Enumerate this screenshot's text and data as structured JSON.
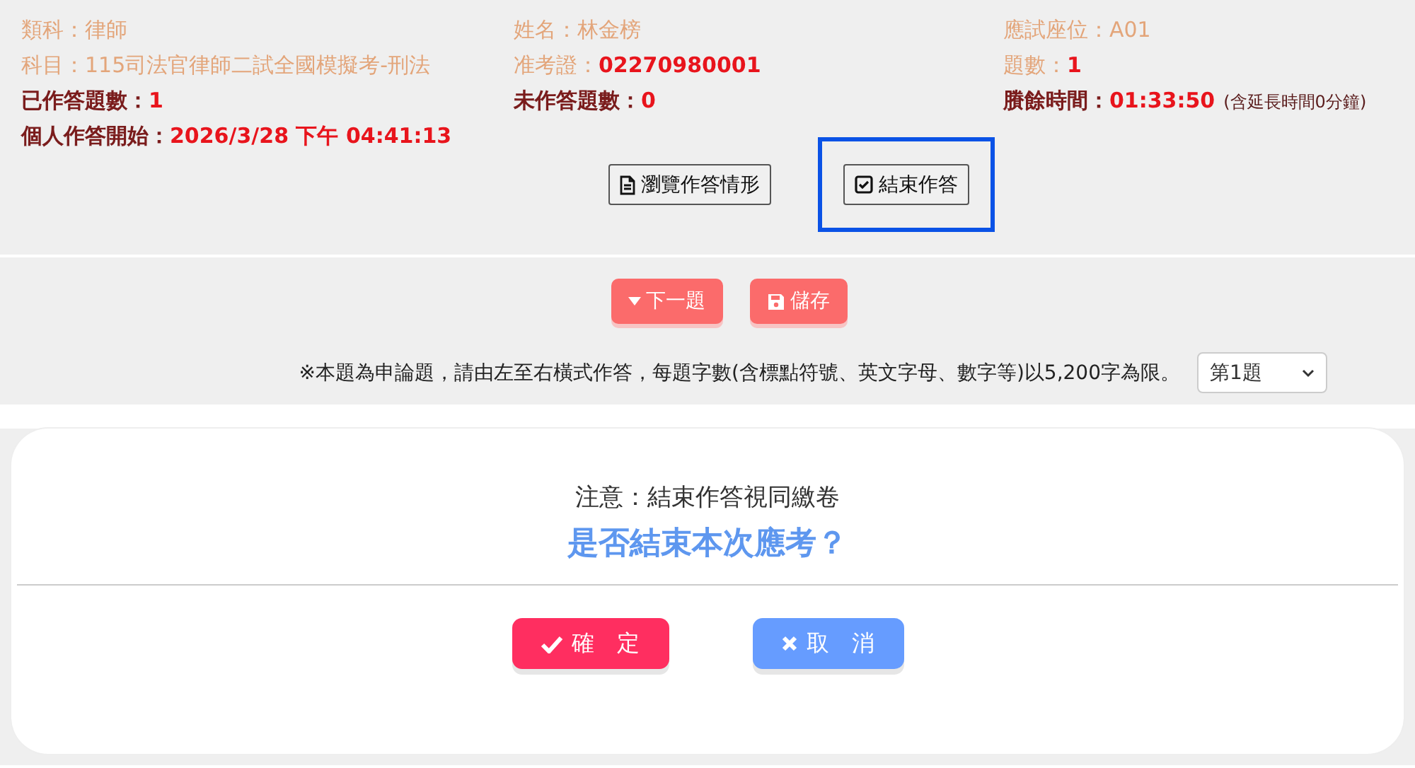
{
  "info": [
    {
      "label": "類科：",
      "value": "律師",
      "dark": false,
      "emphasis": false
    },
    {
      "label": "姓名：",
      "value": "林金榜",
      "dark": false,
      "emphasis": false
    },
    {
      "label": "應試座位：",
      "value": "A01",
      "dark": false,
      "emphasis": false
    },
    {
      "label": "科目：",
      "value": "115司法官律師二試全國模擬考-刑法",
      "dark": false,
      "emphasis": false
    },
    {
      "label": "准考證：",
      "value": "02270980001",
      "dark": false,
      "emphasis": true
    },
    {
      "label": "題數：",
      "value": "1",
      "dark": false,
      "emphasis": true
    },
    {
      "label": "已作答題數：",
      "value": "1",
      "dark": true,
      "emphasis": true
    },
    {
      "label": "未作答題數：",
      "value": "0",
      "dark": true,
      "emphasis": true
    },
    {
      "label": "賸餘時間：",
      "value": "01:33:50",
      "dark": true,
      "emphasis": true,
      "note": "(含延長時間0分鐘)"
    },
    {
      "label": "個人作答開始：",
      "value": "2026/3/28 下午 04:41:13",
      "dark": true,
      "emphasis": true
    }
  ],
  "tools": [
    {
      "label": "瀏覽作答情形",
      "kind": "browse",
      "highlighted": false
    },
    {
      "label": "結束作答",
      "kind": "finish",
      "highlighted": true
    }
  ],
  "actions": [
    {
      "label": "下一題",
      "kind": "next"
    },
    {
      "label": "儲存",
      "kind": "save"
    }
  ],
  "notice": "※本題為申論題，請由左至右橫式作答，每題字數(含標點符號、英文字母、數字等)以5,200字為限。",
  "question_select": {
    "value": "第1題"
  },
  "dialog": {
    "note": "注意：結束作答視同繳卷",
    "question": "是否結束本次應考？",
    "buttons": [
      {
        "label": "確　定",
        "kind": "confirm"
      },
      {
        "label": "取　消",
        "kind": "cancel"
      }
    ]
  }
}
